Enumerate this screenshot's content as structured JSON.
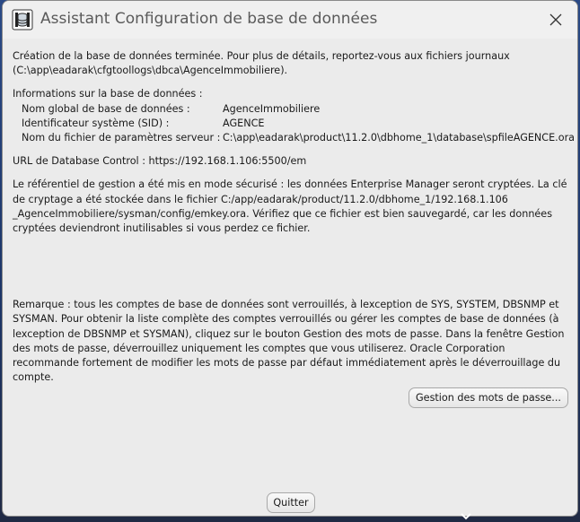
{
  "window": {
    "title": "Assistant Configuration de base de données",
    "icon": "database-config-icon"
  },
  "content": {
    "para1": "Création de la base de données terminée. Pour plus de détails, reportez-vous aux fichiers journaux (C:\\app\\eadarak\\cfgtoollogs\\dbca\\AgenceImmobiliere).",
    "info_heading": "Informations sur la base de données :",
    "info_rows": [
      {
        "label": "Nom global de base de données :",
        "value": "AgenceImmobiliere"
      },
      {
        "label": "Identificateur système (SID) :",
        "value": "AGENCE"
      },
      {
        "label": "Nom du fichier de paramètres serveur :",
        "value": "C:\\app\\eadarak\\product\\11.2.0\\dbhome_1\\database\\spfileAGENCE.ora"
      }
    ],
    "url_line": "URL de Database Control : https://192.168.1.106:5500/em",
    "para_security": "Le référentiel de gestion a été mis en mode sécurisé : les données Enterprise Manager seront cryptées. La clé de cryptage a été stockée dans le fichier C:/app/eadarak/product/11.2.0/dbhome_1/192.168.1.106 _AgenceImmobiliere/sysman/config/emkey.ora. Vérifiez que ce fichier est bien sauvegardé, car les données cryptées deviendront inutilisables si vous perdez ce fichier.",
    "para_remark": "Remarque : tous les comptes de base de données sont verrouillés, à lexception de SYS, SYSTEM, DBSNMP et SYSMAN. Pour obtenir la liste complète des comptes verrouillés ou gérer les comptes de base de données (à lexception de DBSNMP et SYSMAN), cliquez sur le bouton Gestion des mots de passe. Dans la fenêtre Gestion des mots de passe, déverrouillez uniquement les comptes que vous utiliserez. Oracle Corporation recommande fortement de modifier les mots de passe par défaut immédiatement après le déverrouillage du compte."
  },
  "buttons": {
    "password_management": "Gestion des mots de passe...",
    "quit": "Quitter"
  }
}
